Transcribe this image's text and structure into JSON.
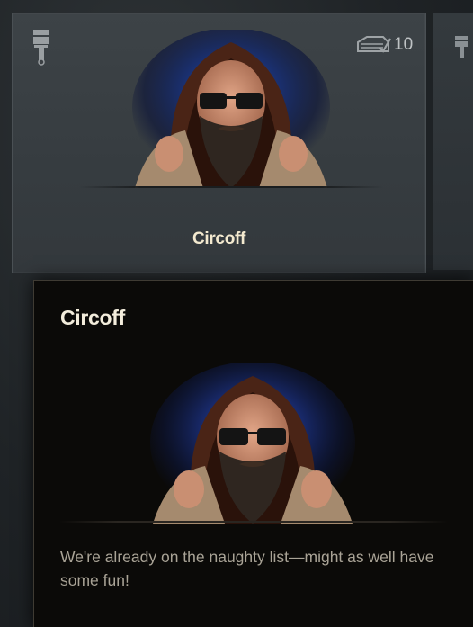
{
  "card": {
    "name": "Circoff",
    "slot_count": "10",
    "icons": {
      "left": "paintbrush-icon",
      "right": "garage-slot-icon"
    }
  },
  "tooltip": {
    "title": "Circoff",
    "description": "We're already on the naughty list—might as well have some fun!"
  },
  "neighbor": {
    "icon": "paintbrush-icon"
  },
  "colors": {
    "card_bg": "#3a4044",
    "title_text": "#f3e9cf",
    "tooltip_bg": "#0b0a08",
    "desc_text": "#a9a396",
    "portrait_glow": "#1d3a8a"
  }
}
